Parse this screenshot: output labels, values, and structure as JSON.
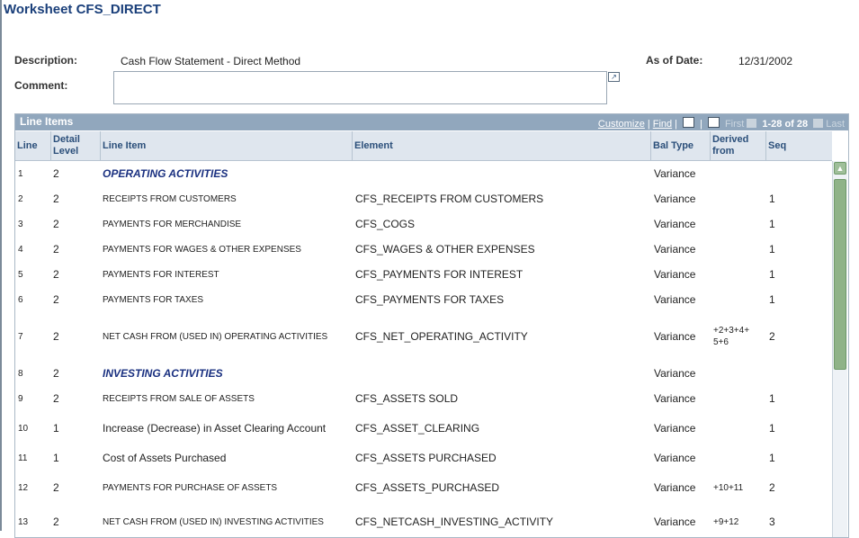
{
  "page": {
    "title": "Worksheet CFS_DIRECT",
    "description_label": "Description:",
    "description_value": "Cash Flow Statement - Direct Method",
    "as_of_label": "As of Date:",
    "as_of_value": "12/31/2002",
    "comment_label": "Comment:",
    "comment_value": ""
  },
  "grid": {
    "title": "Line Items",
    "customize": "Customize",
    "find": "Find",
    "first": "First",
    "range": "1-28 of 28",
    "last": "Last",
    "columns": [
      "Line",
      "Detail Level",
      "Line Item",
      "Element",
      "Bal Type",
      "Derived from",
      "Seq"
    ],
    "rows": [
      {
        "line": "1",
        "level": "2",
        "item": "OPERATING ACTIVITIES",
        "element": "",
        "bal": "Variance",
        "derived": "",
        "seq": ""
      },
      {
        "line": "2",
        "level": "2",
        "item": "RECEIPTS FROM CUSTOMERS",
        "element": "CFS_RECEIPTS FROM CUSTOMERS",
        "bal": "Variance",
        "derived": "",
        "seq": "1"
      },
      {
        "line": "3",
        "level": "2",
        "item": "PAYMENTS FOR MERCHANDISE",
        "element": "CFS_COGS",
        "bal": "Variance",
        "derived": "",
        "seq": "1"
      },
      {
        "line": "4",
        "level": "2",
        "item": "PAYMENTS FOR WAGES & OTHER EXPENSES",
        "element": "CFS_WAGES & OTHER EXPENSES",
        "bal": "Variance",
        "derived": "",
        "seq": "1"
      },
      {
        "line": "5",
        "level": "2",
        "item": "PAYMENTS FOR INTEREST",
        "element": "CFS_PAYMENTS FOR INTEREST",
        "bal": "Variance",
        "derived": "",
        "seq": "1"
      },
      {
        "line": "6",
        "level": "2",
        "item": "PAYMENTS FOR TAXES",
        "element": "CFS_PAYMENTS FOR TAXES",
        "bal": "Variance",
        "derived": "",
        "seq": "1"
      },
      {
        "line": "7",
        "level": "2",
        "item": "NET CASH FROM (USED IN) OPERATING ACTIVITIES",
        "element": "CFS_NET_OPERATING_ACTIVITY",
        "bal": "Variance",
        "derived": "+2+3+4+\n5+6",
        "seq": "2"
      },
      {
        "line": "8",
        "level": "2",
        "item": "INVESTING ACTIVITIES",
        "element": "",
        "bal": "Variance",
        "derived": "",
        "seq": ""
      },
      {
        "line": "9",
        "level": "2",
        "item": "RECEIPTS FROM SALE OF ASSETS",
        "element": "CFS_ASSETS SOLD",
        "bal": "Variance",
        "derived": "",
        "seq": "1"
      },
      {
        "line": "10",
        "level": "1",
        "item": "Increase (Decrease) in Asset Clearing Account",
        "element": "CFS_ASSET_CLEARING",
        "bal": "Variance",
        "derived": "",
        "seq": "1"
      },
      {
        "line": "11",
        "level": "1",
        "item": "Cost of Assets Purchased",
        "element": "CFS_ASSETS PURCHASED",
        "bal": "Variance",
        "derived": "",
        "seq": "1"
      },
      {
        "line": "12",
        "level": "2",
        "item": "PAYMENTS FOR PURCHASE OF ASSETS",
        "element": "CFS_ASSETS_PURCHASED",
        "bal": "Variance",
        "derived": "+10+11",
        "seq": "2"
      },
      {
        "line": "13",
        "level": "2",
        "item": "NET CASH FROM (USED IN) INVESTING ACTIVITIES",
        "element": "CFS_NETCASH_INVESTING_ACTIVITY",
        "bal": "Variance",
        "derived": "+9+12",
        "seq": "3"
      }
    ]
  }
}
